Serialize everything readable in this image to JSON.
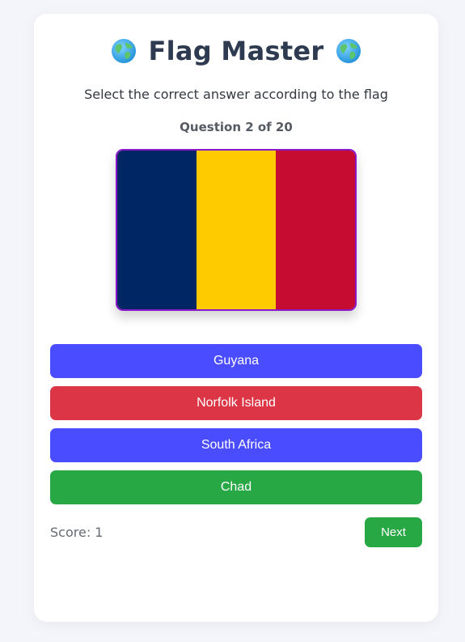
{
  "header": {
    "title": "Flag Master",
    "left_icon": "globe-icon",
    "right_icon": "globe-icon"
  },
  "instruction": "Select the correct answer according to the flag",
  "progress": {
    "label": "Question 2 of 20",
    "current": 2,
    "total": 20
  },
  "flag": {
    "description_icon": "flag-image",
    "stripes": [
      "#002664",
      "#FECB00",
      "#C60C30"
    ],
    "border_color": "#8a17c9"
  },
  "answers": [
    {
      "label": "Guyana",
      "state": "neutral",
      "color": "#4a4dff"
    },
    {
      "label": "Norfolk Island",
      "state": "wrong",
      "color": "#dc3545"
    },
    {
      "label": "South Africa",
      "state": "neutral",
      "color": "#4a4dff"
    },
    {
      "label": "Chad",
      "state": "correct",
      "color": "#28a745"
    }
  ],
  "footer": {
    "score_label": "Score: 1",
    "score": 1,
    "next_label": "Next",
    "next_color": "#28a745"
  }
}
